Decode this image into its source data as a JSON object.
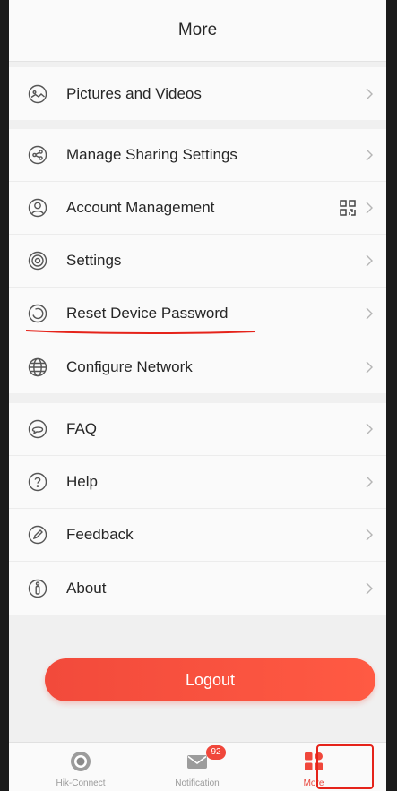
{
  "header": {
    "title": "More"
  },
  "groups": [
    {
      "items": [
        {
          "label": "Pictures and Videos",
          "icon": "pictures-videos-icon"
        }
      ]
    },
    {
      "items": [
        {
          "label": "Manage Sharing Settings",
          "icon": "share-icon"
        },
        {
          "label": "Account Management",
          "icon": "account-icon",
          "extra_icon": "qr-code-icon"
        },
        {
          "label": "Settings",
          "icon": "settings-icon"
        },
        {
          "label": "Reset Device Password",
          "icon": "reset-icon",
          "annotated": true
        },
        {
          "label": "Configure Network",
          "icon": "globe-icon"
        }
      ]
    },
    {
      "items": [
        {
          "label": "FAQ",
          "icon": "faq-icon"
        },
        {
          "label": "Help",
          "icon": "help-icon"
        },
        {
          "label": "Feedback",
          "icon": "feedback-icon"
        },
        {
          "label": "About",
          "icon": "about-icon"
        }
      ]
    }
  ],
  "logout": {
    "label": "Logout"
  },
  "tabbar": {
    "tabs": [
      {
        "label": "Hik-Connect",
        "icon": "hik-connect-icon",
        "active": false
      },
      {
        "label": "Notification",
        "icon": "mail-icon",
        "badge": "92",
        "active": false
      },
      {
        "label": "More",
        "icon": "grid-icon",
        "active": true
      }
    ]
  },
  "colors": {
    "accent": "#f24a3b",
    "background": "#f0f0f0",
    "surface": "#fafafa",
    "text": "#262626",
    "icon": "#555555",
    "annotation": "#e5231a"
  }
}
